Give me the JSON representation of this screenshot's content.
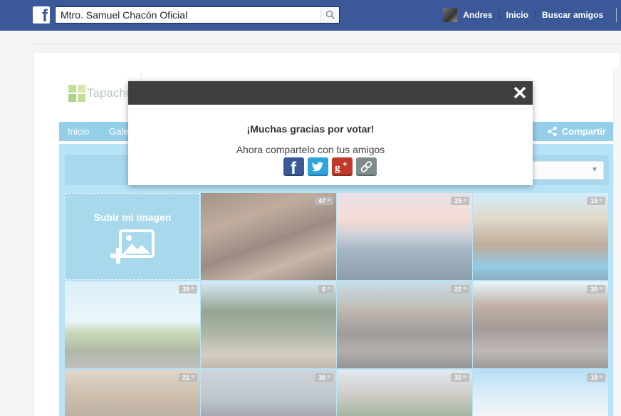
{
  "topbar": {
    "search_value": "Mtro. Samuel Chacón Oficial",
    "user_name": "Andres",
    "home_label": "Inicio",
    "find_friends_label": "Buscar amigos"
  },
  "app": {
    "logo_text": "Tapachul",
    "nav_items": [
      "Inicio",
      "Gale"
    ],
    "share_label": "Compartir",
    "upload_label": "Subir mi imagen",
    "tiles": [
      {
        "votes": "47 º"
      },
      {
        "votes": "25 º"
      },
      {
        "votes": "19 º"
      },
      {
        "votes": "39 º"
      },
      {
        "votes": "6 º"
      },
      {
        "votes": "22 º"
      },
      {
        "votes": "30 º"
      },
      {
        "votes": "21 º"
      },
      {
        "votes": "38 º"
      },
      {
        "votes": "32 º"
      },
      {
        "votes": "18 º"
      }
    ]
  },
  "modal": {
    "title": "¡Muchas gracias por votar!",
    "subtitle": "Ahora compartelo con tus amigos",
    "share_icons": [
      "facebook-icon",
      "twitter-icon",
      "google-plus-icon",
      "link-icon"
    ]
  },
  "colors": {
    "fb_blue": "#3b5998",
    "app_blue": "#3da8d8",
    "modal_header": "#3f3f3f",
    "facebook": "#3b5998",
    "twitter": "#2ea5dd",
    "google_plus": "#c0392b",
    "link": "#7f8c8d"
  }
}
